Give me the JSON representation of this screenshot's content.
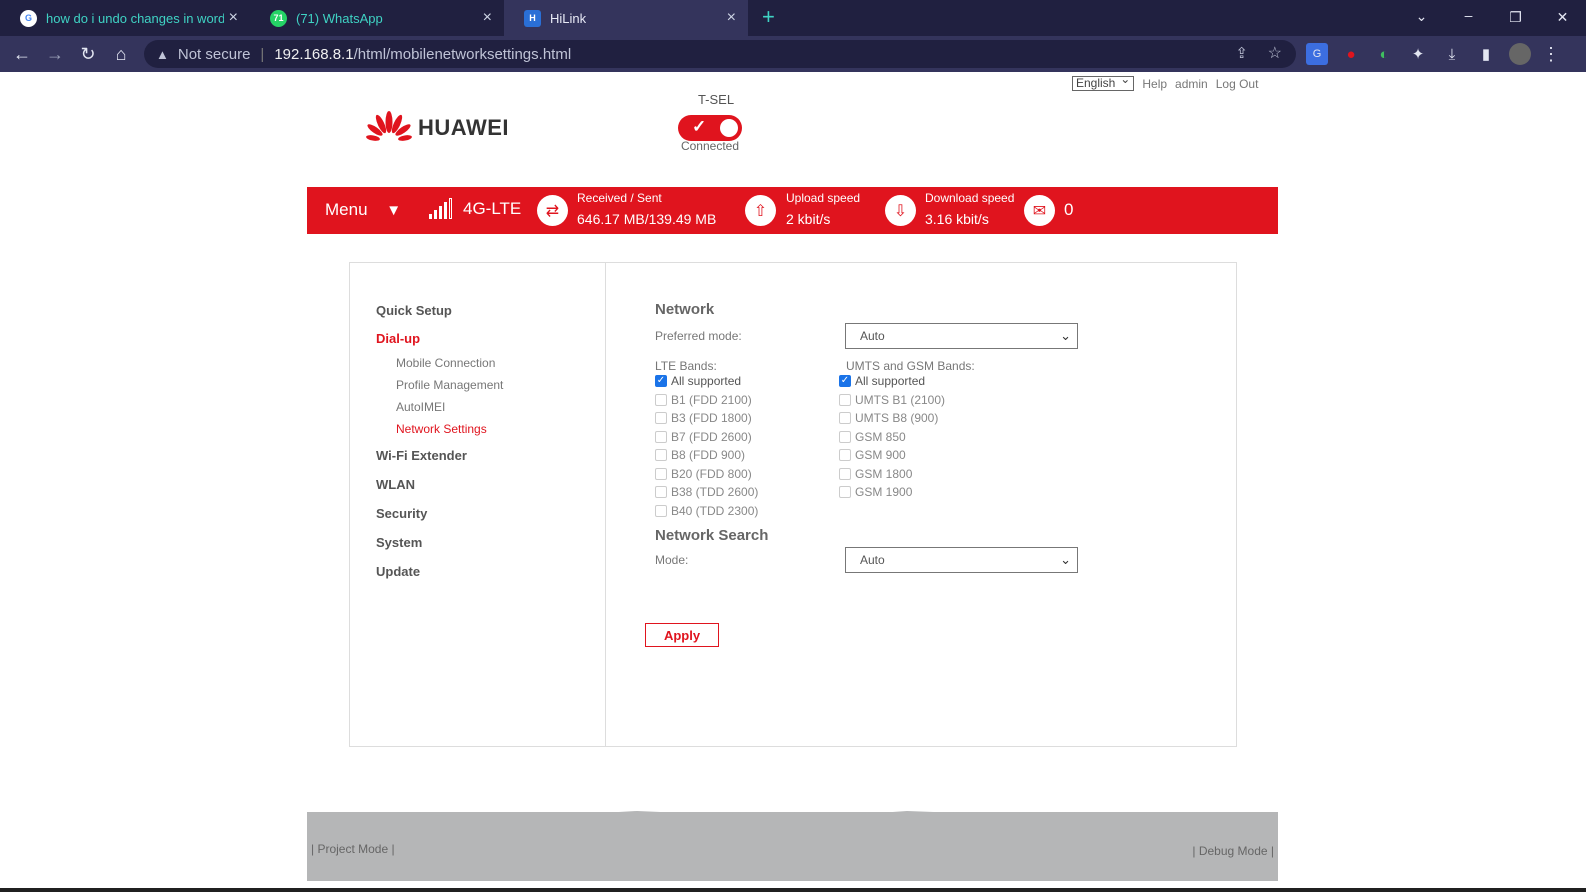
{
  "browser": {
    "tabs": [
      {
        "title": "how do i undo changes in word a",
        "icon": "google-icon",
        "close": "×"
      },
      {
        "title": "(71) WhatsApp",
        "icon": "whatsapp-icon",
        "badge": "71",
        "close": "×"
      },
      {
        "title": "HiLink",
        "icon": "hilink-icon",
        "close": "×"
      }
    ],
    "new_tab": "+",
    "security_label": "Not secure",
    "url_host": "192.168.8.1",
    "url_path": "/html/mobilenetworksettings.html"
  },
  "header": {
    "language": "English",
    "help": "Help",
    "user": "admin",
    "logout": "Log Out",
    "brand": "HUAWEI",
    "carrier": "T-SEL",
    "connection_status": "Connected"
  },
  "statusbar": {
    "menu": "Menu",
    "network_type": "4G-LTE",
    "received_sent_label": "Received / Sent",
    "received_sent_value": "646.17 MB/139.49 MB",
    "upload_label": "Upload speed",
    "upload_value": "2 kbit/s",
    "download_label": "Download speed",
    "download_value": "3.16 kbit/s",
    "messages": "0"
  },
  "sidebar": {
    "items": [
      {
        "label": "Quick Setup"
      },
      {
        "label": "Dial-up"
      },
      {
        "label": "Wi-Fi Extender"
      },
      {
        "label": "WLAN"
      },
      {
        "label": "Security"
      },
      {
        "label": "System"
      },
      {
        "label": "Update"
      }
    ],
    "subitems": [
      {
        "label": "Mobile Connection"
      },
      {
        "label": "Profile Management"
      },
      {
        "label": "AutoIMEI"
      },
      {
        "label": "Network Settings"
      }
    ]
  },
  "network": {
    "title": "Network",
    "preferred_mode_label": "Preferred mode:",
    "preferred_mode_value": "Auto",
    "lte_label": "LTE Bands:",
    "lte_bands": [
      {
        "label": "All supported",
        "checked": true
      },
      {
        "label": "B1 (FDD 2100)",
        "checked": false
      },
      {
        "label": "B3 (FDD 1800)",
        "checked": false
      },
      {
        "label": "B7 (FDD 2600)",
        "checked": false
      },
      {
        "label": "B8 (FDD 900)",
        "checked": false
      },
      {
        "label": "B20 (FDD 800)",
        "checked": false
      },
      {
        "label": "B38 (TDD 2600)",
        "checked": false
      },
      {
        "label": "B40 (TDD 2300)",
        "checked": false
      }
    ],
    "umts_label": "UMTS and GSM Bands:",
    "umts_bands": [
      {
        "label": "All supported",
        "checked": true
      },
      {
        "label": "UMTS B1 (2100)",
        "checked": false
      },
      {
        "label": "UMTS B8 (900)",
        "checked": false
      },
      {
        "label": "GSM 850",
        "checked": false
      },
      {
        "label": "GSM 900",
        "checked": false
      },
      {
        "label": "GSM 1800",
        "checked": false
      },
      {
        "label": "GSM 1900",
        "checked": false
      }
    ],
    "search_title": "Network Search",
    "search_mode_label": "Mode:",
    "search_mode_value": "Auto",
    "apply": "Apply"
  },
  "footer": {
    "project_mode": "Project Mode",
    "debug_mode": "Debug Mode"
  },
  "colors": {
    "accent": "#e0141e",
    "browser_dark": "#202040",
    "browser_active": "#34345c"
  }
}
